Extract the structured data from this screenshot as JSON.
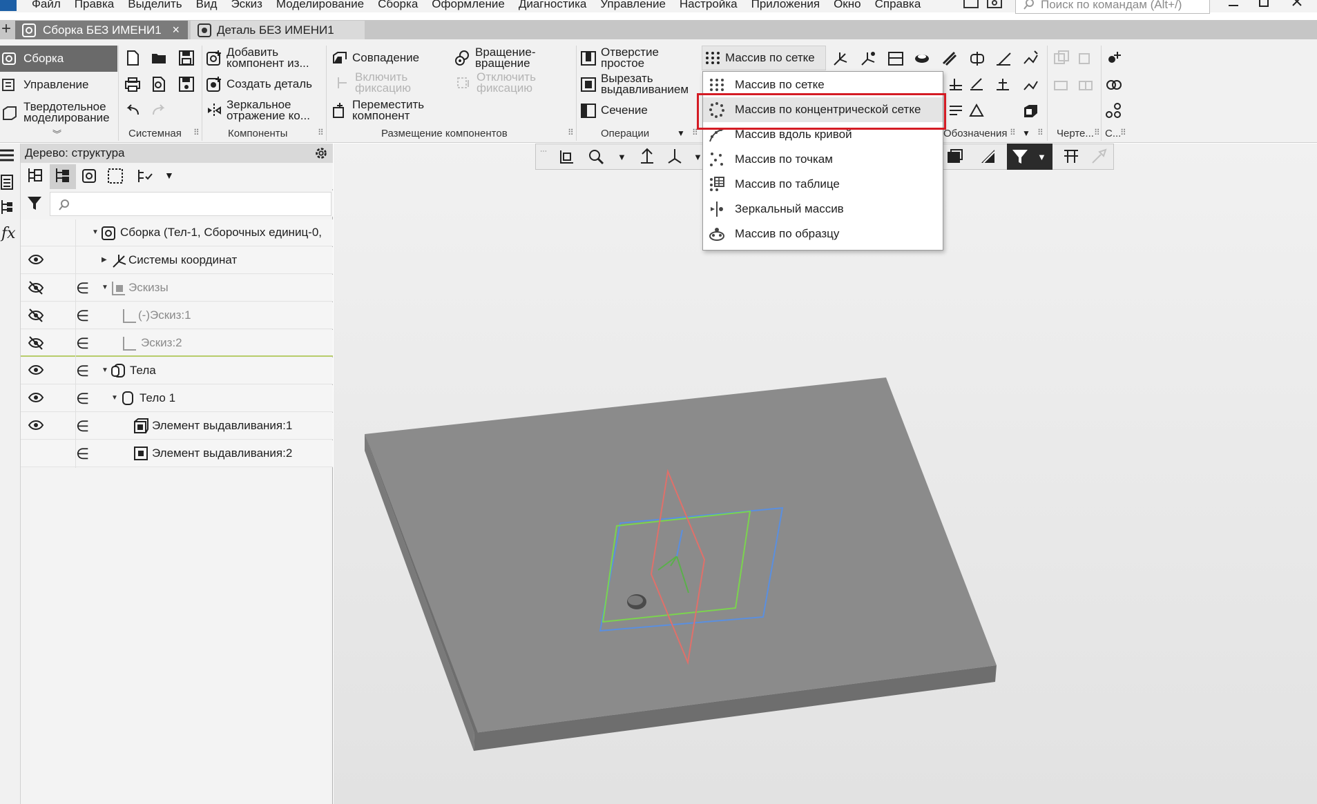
{
  "menu": {
    "items": [
      "Файл",
      "Правка",
      "Выделить",
      "Вид",
      "Эскиз",
      "Моделирование",
      "Сборка",
      "Оформление",
      "Диагностика",
      "Управление",
      "Настройка",
      "Приложения",
      "Окно",
      "Справка"
    ],
    "search_placeholder": "Поиск по командам (Alt+/)"
  },
  "tabs": {
    "assembly": "Сборка БЕЗ ИМЕНИ1",
    "part": "Деталь БЕЗ ИМЕНИ1",
    "close": "×",
    "plus": "+"
  },
  "ribbon": {
    "modes": {
      "assembly": "Сборка",
      "management": "Управление",
      "solid_1": "Твердотельное",
      "solid_2": "моделирование"
    },
    "components": {
      "add_1": "Добавить",
      "add_2": "компонент из...",
      "create_part": "Создать деталь",
      "mirror_1": "Зеркальное",
      "mirror_2": "отражение ко..."
    },
    "placement": {
      "coincidence": "Совпадение",
      "rotation_1": "Вращение-",
      "rotation_2": "вращение",
      "enable_fix_1": "Включить",
      "enable_fix_2": "фиксацию",
      "disable_fix_1": "Отключить",
      "disable_fix_2": "фиксацию",
      "move_1": "Переместить",
      "move_2": "компонент"
    },
    "operations": {
      "hole_1": "Отверстие",
      "hole_2": "простое",
      "cut_1": "Вырезать",
      "cut_2": "выдавливанием",
      "section": "Сечение"
    },
    "array_button": "Массив по сетке",
    "groups": {
      "system": "Системная",
      "components": "Компоненты",
      "placement": "Размещение компонентов",
      "operations": "Операции",
      "designations": "Обозначения",
      "drawing": "Черте...",
      "c": "С..."
    }
  },
  "array_dropdown": {
    "items": [
      "Массив по сетке",
      "Массив по концентрической сетке",
      "Массив вдоль кривой",
      "Массив по точкам",
      "Массив по таблице",
      "Зеркальный массив",
      "Массив по образцу"
    ],
    "highlight_color": "#d41b24"
  },
  "tree": {
    "title": "Дерево: структура",
    "rows": {
      "root": "Сборка (Тел-1, Сборочных единиц-0,",
      "coords": "Системы координат",
      "sketches": "Эскизы",
      "sketch1": "(-)Эскиз:1",
      "sketch2": "Эскиз:2",
      "bodies": "Тела",
      "body1": "Тело 1",
      "extrude1": "Элемент выдавливания:1",
      "extrude2": "Элемент выдавливания:2"
    },
    "member_symbol": "∈"
  },
  "left_strip": {
    "fx": "fx"
  },
  "colors": {
    "active_mode": "#6a6a6a",
    "tab_active": "#7b7b7b",
    "plate": "#8a8a8a",
    "plane_green": "#7bd44e",
    "plane_red": "#e0706a",
    "plane_blue": "#5a8fe0"
  }
}
